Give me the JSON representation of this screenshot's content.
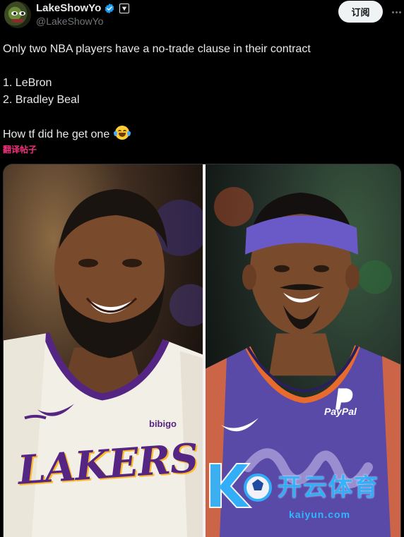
{
  "author": {
    "display_name": "LakeShowYo",
    "handle": "@LakeShowYo",
    "avatar_icon": "pepe-frog-avatar",
    "verified_icon": "verified-badge-icon",
    "affiliate_icon": "affiliate-badge-icon"
  },
  "actions": {
    "subscribe_label": "订阅",
    "more_icon": "more-options-icon"
  },
  "tweet": {
    "line1": "Only two NBA players have a no-trade clause in their contract",
    "line2": "1. LeBron",
    "line3": "2. Bradley Beal",
    "line4": "How tf did he get one",
    "emoji": "face-with-tears-of-joy-emoji",
    "translate_label": "翻译帖子"
  },
  "media": {
    "left_jersey": "LAKERS",
    "left_sponsor": "bibigo",
    "right_sponsor": "PayPal",
    "watermark_text": "开云体育",
    "watermark_sub": "kaiyun.com"
  },
  "colors": {
    "background": "#000000",
    "text": "#e7e9ea",
    "muted": "#71767b",
    "translate": "#f2317e",
    "verified": "#1d9bf0",
    "lakers_purple": "#552583",
    "lakers_gold": "#fdb927",
    "suns_purple": "#5a4aa8",
    "watermark": "#2fb6ff"
  }
}
